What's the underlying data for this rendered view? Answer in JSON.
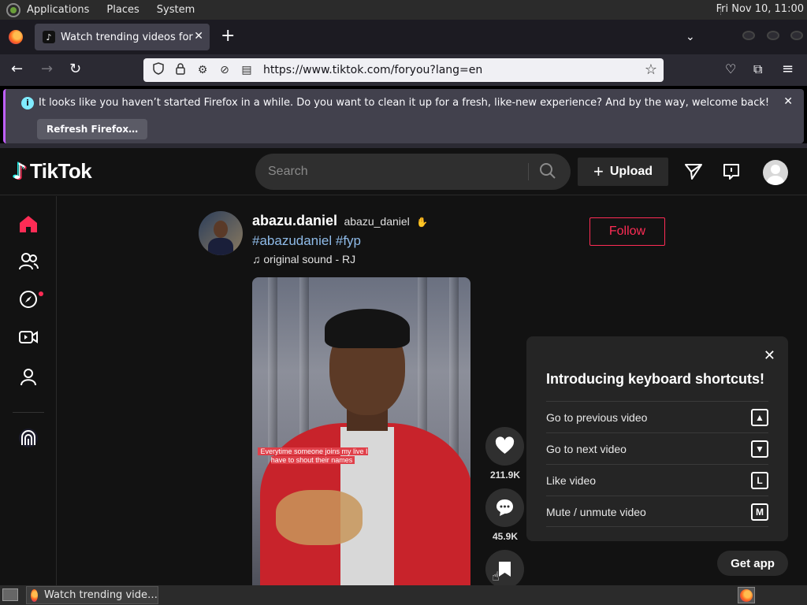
{
  "system_panel": {
    "menus": [
      "Applications",
      "Places",
      "System"
    ],
    "clock": "Fri Nov 10, 11:00"
  },
  "browser": {
    "tab_title": "Watch trending videos for y",
    "url": "https://www.tiktok.com/foryou?lang=en",
    "notification": {
      "message": "It looks like you haven’t started Firefox in a while. Do you want to clean it up for a fresh, like-new experience? And by the way, welcome back!",
      "button": "Refresh Firefox…"
    }
  },
  "tiktok": {
    "logo": "TikTok",
    "search_placeholder": "Search",
    "upload_label": "Upload",
    "post": {
      "username": "abazu.daniel",
      "handle": "abazu_daniel",
      "badge": "✋",
      "tags": "#abazudaniel #fyp",
      "sound": "original sound - RJ",
      "follow_label": "Follow",
      "caption": "Everytime someone joins my live I have to shout their names",
      "likes": "211.9K",
      "comments": "45.9K"
    },
    "shortcuts": {
      "title": "Introducing keyboard shortcuts!",
      "items": [
        {
          "label": "Go to previous video",
          "key": "▲"
        },
        {
          "label": "Go to next video",
          "key": "▼"
        },
        {
          "label": "Like video",
          "key": "L"
        },
        {
          "label": "Mute / unmute video",
          "key": "M"
        }
      ]
    },
    "get_app": "Get app"
  },
  "taskbar": {
    "task_label": "Watch trending vide…"
  },
  "colors": {
    "accent": "#fe2c55",
    "tag_blue": "#8fbbe8"
  }
}
